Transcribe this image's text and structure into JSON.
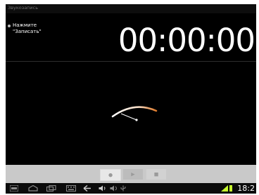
{
  "app": {
    "title": "Звукозапись"
  },
  "hint": {
    "line1": "Нажмите",
    "line2": "\"Записать\""
  },
  "timer": {
    "display": "00:00:00"
  },
  "controls": {
    "record": {
      "icon": "record-icon"
    },
    "play": {
      "icon": "play-icon"
    },
    "stop": {
      "icon": "stop-icon"
    }
  },
  "navbar": {
    "icons": [
      "menu-icon",
      "home-icon",
      "recent-apps-icon",
      "keyboard-icon",
      "back-icon",
      "volume-down-icon",
      "volume-up-icon",
      "usb-icon"
    ],
    "time": "18:2"
  },
  "colors": {
    "screen_bg": "#000000",
    "control_bar": "#c9c9c9",
    "gauge_arc": "#ffffff",
    "gauge_accent": "#e07a2b",
    "battery": "#c8ff2e"
  }
}
